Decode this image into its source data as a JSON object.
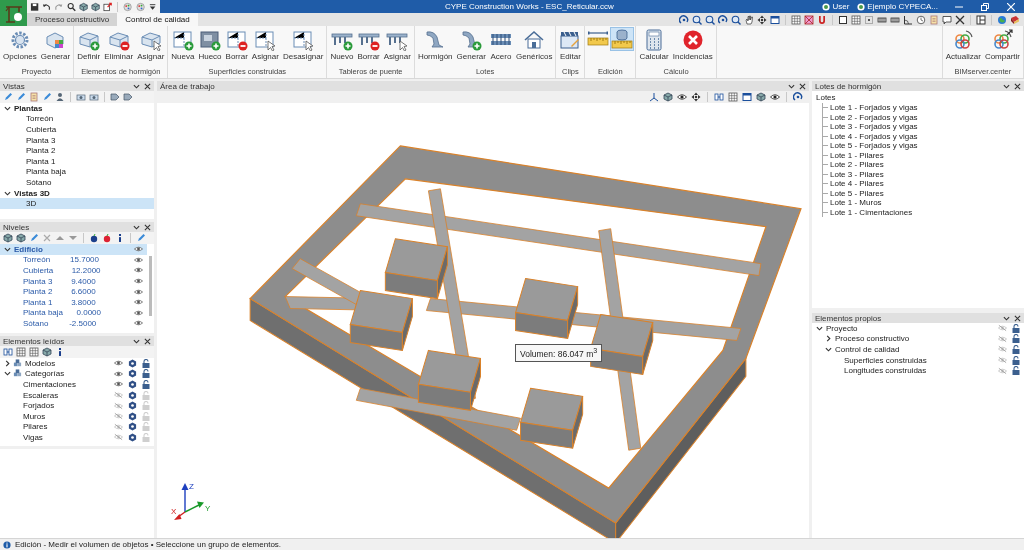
{
  "window": {
    "title": "CYPE Construction Works - ESC_Reticular.ccw",
    "user": "User",
    "project": "Ejemplo CYPECA..."
  },
  "tabs": [
    {
      "label": "Proceso constructivo",
      "selected": false
    },
    {
      "label": "Control de calidad",
      "selected": true
    }
  ],
  "ribbon": [
    {
      "label": "Proyecto",
      "buttons": [
        {
          "label": "Opciones"
        },
        {
          "label": "Generar"
        }
      ]
    },
    {
      "label": "Elementos de hormigón",
      "buttons": [
        {
          "label": "Definir"
        },
        {
          "label": "Eliminar"
        },
        {
          "label": "Asignar"
        }
      ]
    },
    {
      "label": "Superficies construidas",
      "buttons": [
        {
          "label": "Nueva"
        },
        {
          "label": "Hueco"
        },
        {
          "label": "Borrar"
        },
        {
          "label": "Asignar"
        },
        {
          "label": "Desasignar"
        }
      ]
    },
    {
      "label": "Tableros de puente",
      "buttons": [
        {
          "label": "Nuevo"
        },
        {
          "label": "Borrar"
        },
        {
          "label": "Asignar"
        }
      ]
    },
    {
      "label": "Lotes",
      "buttons": [
        {
          "label": "Hormigón"
        },
        {
          "label": "Generar"
        },
        {
          "label": "Acero"
        },
        {
          "label": "Genéricos"
        }
      ]
    },
    {
      "label": "Clips",
      "buttons": [
        {
          "label": "Editar"
        }
      ]
    },
    {
      "label": "Edición",
      "buttons": [
        {
          "selected": false
        },
        {
          "selected": true
        }
      ]
    },
    {
      "label": "Cálculo",
      "buttons": [
        {
          "label": "Calcular"
        },
        {
          "label": "Incidencias"
        }
      ]
    },
    {
      "label": "BIMserver.center",
      "buttons": [
        {
          "label": "Actualizar"
        },
        {
          "label": "Compartir"
        }
      ]
    }
  ],
  "views_panel": {
    "title": "Vistas",
    "tree": [
      {
        "label": "Plantas",
        "expanded": true,
        "selected": false,
        "children": [
          {
            "label": "Torreón",
            "selected": false
          },
          {
            "label": "Cubierta",
            "selected": false
          },
          {
            "label": "Planta 3",
            "selected": false
          },
          {
            "label": "Planta 2",
            "selected": false
          },
          {
            "label": "Planta 1",
            "selected": false
          },
          {
            "label": "Planta baja",
            "selected": false
          },
          {
            "label": "Sótano",
            "selected": false
          }
        ]
      },
      {
        "label": "Vistas 3D",
        "expanded": true,
        "selected": false,
        "children": [
          {
            "label": "3D",
            "selected": true
          }
        ]
      }
    ]
  },
  "levels_panel": {
    "title": "Niveles",
    "building": {
      "label": "Edificio",
      "expanded": true,
      "selected": true,
      "levels": [
        {
          "name": "Torreón",
          "elevation": "15.7000"
        },
        {
          "name": "Cubierta",
          "elevation": "12.2000"
        },
        {
          "name": "Planta 3",
          "elevation": "9.4000"
        },
        {
          "name": "Planta 2",
          "elevation": "6.6000"
        },
        {
          "name": "Planta 1",
          "elevation": "3.8000"
        },
        {
          "name": "Planta baja",
          "elevation": "0.0000"
        },
        {
          "name": "Sótano",
          "elevation": "-2.5000"
        }
      ]
    }
  },
  "read_elements_panel": {
    "title": "Elementos leídos",
    "items": [
      {
        "label": "Modelos",
        "expanded": false,
        "visible": true,
        "locked": true
      },
      {
        "label": "Categorías",
        "expanded": true,
        "visible": true,
        "locked": true,
        "children": [
          {
            "label": "Cimentaciones",
            "visible": true,
            "locked": true
          },
          {
            "label": "Escaleras",
            "visible": false,
            "locked": false
          },
          {
            "label": "Forjados",
            "visible": false,
            "locked": false
          },
          {
            "label": "Muros",
            "visible": false,
            "locked": false
          },
          {
            "label": "Pilares",
            "visible": false,
            "locked": false
          },
          {
            "label": "Vigas",
            "visible": false,
            "locked": false
          }
        ]
      }
    ]
  },
  "workspace": {
    "title": "Área de trabajo",
    "tooltip": "Volumen: 86.047 m$^{3}$",
    "axes": {
      "x": "X",
      "y": "Y",
      "z": "Z"
    }
  },
  "batches_panel": {
    "title": "Lotes de hormigón",
    "root": "Lotes",
    "items": [
      "Lote 1 - Forjados y vigas",
      "Lote 2 - Forjados y vigas",
      "Lote 3 - Forjados y vigas",
      "Lote 4 - Forjados y vigas",
      "Lote 5 - Forjados y vigas",
      "Lote 1 - Pilares",
      "Lote 2 - Pilares",
      "Lote 3 - Pilares",
      "Lote 4 - Pilares",
      "Lote 5 - Pilares",
      "Lote 1 - Muros",
      "Lote 1 - Cimentaciones"
    ]
  },
  "own_elements_panel": {
    "title": "Elementos propios",
    "items": [
      {
        "label": "Proyecto",
        "expanded": true,
        "visible": false,
        "locked": true,
        "children": [
          {
            "label": "Proceso constructivo",
            "expanded": false,
            "visible": false,
            "locked": true
          },
          {
            "label": "Control de calidad",
            "expanded": true,
            "visible": false,
            "locked": true,
            "children": [
              {
                "label": "Superficies construidas",
                "visible": false,
                "locked": true
              },
              {
                "label": "Longitudes construidas",
                "visible": false,
                "locked": true
              }
            ]
          }
        ]
      }
    ]
  },
  "status_bar": {
    "text": "Edición - Medir el volumen de objetos • Seleccione un grupo de elementos."
  }
}
